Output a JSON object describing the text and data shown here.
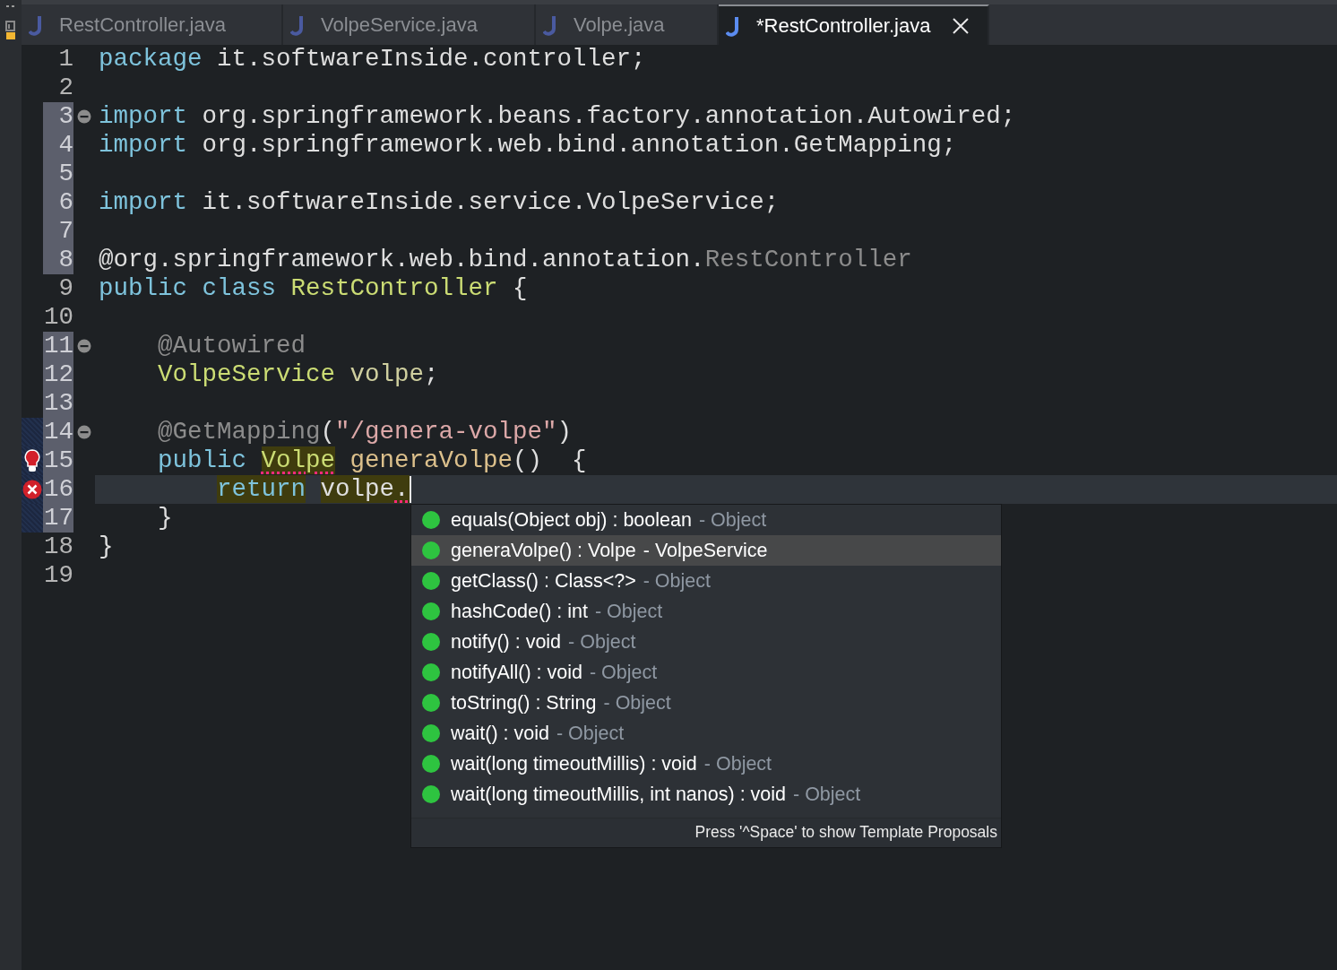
{
  "tabs": [
    {
      "label": "RestController.java",
      "selected": false,
      "closable": false
    },
    {
      "label": "VolpeService.java",
      "selected": false,
      "closable": false
    },
    {
      "label": "Volpe.java",
      "selected": false,
      "closable": false
    },
    {
      "label": "*RestController.java",
      "selected": true,
      "closable": true
    }
  ],
  "editor": {
    "lines": [
      {
        "number": "1",
        "marked": false,
        "changed": false,
        "current": false,
        "tokens": [
          {
            "text": "package",
            "kind": "keyword"
          },
          {
            "text": " it.softwareInside.controller;",
            "kind": "plain"
          }
        ]
      },
      {
        "number": "2",
        "marked": false,
        "changed": false,
        "current": false
      },
      {
        "number": "3",
        "marked": true,
        "changed": false,
        "current": false,
        "marker": {
          "kind": "fold"
        },
        "tokens": [
          {
            "text": "import",
            "kind": "keyword"
          },
          {
            "text": " org.springframework.beans.factory.annotation.Autowired;",
            "kind": "plain"
          }
        ]
      },
      {
        "number": "4",
        "marked": true,
        "changed": false,
        "current": false,
        "tokens": [
          {
            "text": "import",
            "kind": "keyword"
          },
          {
            "text": " org.springframework.web.bind.annotation.GetMapping;",
            "kind": "plain"
          }
        ]
      },
      {
        "number": "5",
        "marked": true,
        "changed": false,
        "current": false
      },
      {
        "number": "6",
        "marked": true,
        "changed": false,
        "current": false,
        "tokens": [
          {
            "text": "import",
            "kind": "keyword"
          },
          {
            "text": " it.softwareInside.service.VolpeService;",
            "kind": "plain"
          }
        ]
      },
      {
        "number": "7",
        "marked": true,
        "changed": false,
        "current": false
      },
      {
        "number": "8",
        "marked": true,
        "changed": false,
        "current": false,
        "tokens": [
          {
            "text": "@org.springframework.web.bind.annotation.",
            "kind": "plain"
          },
          {
            "text": "RestController",
            "kind": "annotation"
          }
        ]
      },
      {
        "number": "9",
        "marked": false,
        "changed": false,
        "current": false,
        "tokens": [
          {
            "text": "public class",
            "kind": "keyword"
          },
          {
            "text": " RestController",
            "kind": "type"
          },
          {
            "text": " {",
            "kind": "plain"
          }
        ]
      },
      {
        "number": "10",
        "marked": false,
        "changed": false,
        "current": false
      },
      {
        "number": "11",
        "marked": true,
        "changed": false,
        "current": false,
        "marker": {
          "kind": "fold"
        },
        "tokens": [
          {
            "text": "    @Autowired",
            "kind": "annotation"
          }
        ]
      },
      {
        "number": "12",
        "marked": true,
        "changed": false,
        "current": false,
        "tokens": [
          {
            "text": "    VolpeService",
            "kind": "type"
          },
          {
            "text": " volpe",
            "kind": "field"
          },
          {
            "text": ";",
            "kind": "plain"
          }
        ]
      },
      {
        "number": "13",
        "marked": true,
        "changed": false,
        "current": false
      },
      {
        "number": "14",
        "marked": true,
        "changed": true,
        "current": false,
        "marker": {
          "kind": "fold"
        },
        "tokens": [
          {
            "text": "    @GetMapping",
            "kind": "annotation"
          },
          {
            "text": "(",
            "kind": "plain"
          },
          {
            "text": "\"/genera-volpe\"",
            "kind": "string"
          },
          {
            "text": ")",
            "kind": "plain"
          }
        ]
      },
      {
        "number": "15",
        "marked": true,
        "changed": true,
        "current": false,
        "marker": {
          "kind": "lightbulb"
        },
        "tokens": [
          {
            "text": "    public ",
            "kind": "keyword"
          },
          {
            "text": "Volpe",
            "kind": "type",
            "highlight": true,
            "error_underline": true
          },
          {
            "text": " generaVolpe",
            "kind": "method"
          },
          {
            "text": "()  {",
            "kind": "plain"
          }
        ]
      },
      {
        "number": "16",
        "marked": true,
        "changed": true,
        "current": true,
        "marker": {
          "kind": "error"
        },
        "tokens": [
          {
            "text": "        return",
            "kind": "keyword",
            "highlight": true
          },
          {
            "text": " volpe",
            "kind": "plain",
            "highlight": true
          },
          {
            "text": ".",
            "kind": "plain",
            "highlight": true,
            "error_underline": true
          }
        ]
      },
      {
        "number": "17",
        "marked": true,
        "changed": true,
        "current": false,
        "tokens": [
          {
            "text": "    }",
            "kind": "plain"
          }
        ]
      },
      {
        "number": "18",
        "marked": false,
        "changed": false,
        "current": false,
        "tokens": [
          {
            "text": "}",
            "kind": "plain"
          }
        ]
      },
      {
        "number": "19",
        "marked": false,
        "changed": false,
        "current": false
      }
    ]
  },
  "proposals": {
    "items": [
      {
        "signature": "equals(Object obj) : boolean",
        "detail": "- Object",
        "selected": false
      },
      {
        "signature": "generaVolpe() : Volpe",
        "detail": "- VolpeService",
        "selected": true
      },
      {
        "signature": "getClass() : Class<?>",
        "detail": "- Object",
        "selected": false
      },
      {
        "signature": "hashCode() : int",
        "detail": "- Object",
        "selected": false
      },
      {
        "signature": "notify() : void",
        "detail": "- Object",
        "selected": false
      },
      {
        "signature": "notifyAll() : void",
        "detail": "- Object",
        "selected": false
      },
      {
        "signature": "toString() : String",
        "detail": "- Object",
        "selected": false
      },
      {
        "signature": "wait() : void",
        "detail": "- Object",
        "selected": false
      },
      {
        "signature": "wait(long timeoutMillis) : void",
        "detail": "- Object",
        "selected": false
      },
      {
        "signature": "wait(long timeoutMillis, int nanos) : void",
        "detail": "- Object",
        "selected": false
      }
    ],
    "footer": "Press '^Space' to show Template Proposals"
  }
}
